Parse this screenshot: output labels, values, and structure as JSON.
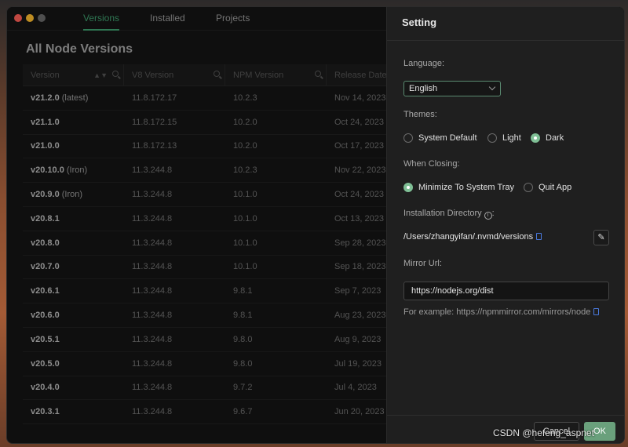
{
  "window": {
    "tabs": [
      {
        "label": "Versions",
        "active": true
      },
      {
        "label": "Installed",
        "active": false
      },
      {
        "label": "Projects",
        "active": false
      }
    ]
  },
  "page_title": "All Node Versions",
  "table": {
    "headers": [
      "Version",
      "V8 Version",
      "NPM Version",
      "Release Date"
    ],
    "rows": [
      {
        "version": "v21.2.0",
        "tag": "(latest)",
        "v8": "11.8.172.17",
        "npm": "10.2.3",
        "date": "Nov 14, 2023"
      },
      {
        "version": "v21.1.0",
        "tag": "",
        "v8": "11.8.172.15",
        "npm": "10.2.0",
        "date": "Oct 24, 2023"
      },
      {
        "version": "v21.0.0",
        "tag": "",
        "v8": "11.8.172.13",
        "npm": "10.2.0",
        "date": "Oct 17, 2023"
      },
      {
        "version": "v20.10.0",
        "tag": "(Iron)",
        "v8": "11.3.244.8",
        "npm": "10.2.3",
        "date": "Nov 22, 2023"
      },
      {
        "version": "v20.9.0",
        "tag": "(Iron)",
        "v8": "11.3.244.8",
        "npm": "10.1.0",
        "date": "Oct 24, 2023"
      },
      {
        "version": "v20.8.1",
        "tag": "",
        "v8": "11.3.244.8",
        "npm": "10.1.0",
        "date": "Oct 13, 2023"
      },
      {
        "version": "v20.8.0",
        "tag": "",
        "v8": "11.3.244.8",
        "npm": "10.1.0",
        "date": "Sep 28, 2023"
      },
      {
        "version": "v20.7.0",
        "tag": "",
        "v8": "11.3.244.8",
        "npm": "10.1.0",
        "date": "Sep 18, 2023"
      },
      {
        "version": "v20.6.1",
        "tag": "",
        "v8": "11.3.244.8",
        "npm": "9.8.1",
        "date": "Sep 7, 2023"
      },
      {
        "version": "v20.6.0",
        "tag": "",
        "v8": "11.3.244.8",
        "npm": "9.8.1",
        "date": "Aug 23, 2023"
      },
      {
        "version": "v20.5.1",
        "tag": "",
        "v8": "11.3.244.8",
        "npm": "9.8.0",
        "date": "Aug 9, 2023"
      },
      {
        "version": "v20.5.0",
        "tag": "",
        "v8": "11.3.244.8",
        "npm": "9.8.0",
        "date": "Jul 19, 2023"
      },
      {
        "version": "v20.4.0",
        "tag": "",
        "v8": "11.3.244.8",
        "npm": "9.7.2",
        "date": "Jul 4, 2023"
      },
      {
        "version": "v20.3.1",
        "tag": "",
        "v8": "11.3.244.8",
        "npm": "9.6.7",
        "date": "Jun 20, 2023"
      }
    ]
  },
  "setting": {
    "title": "Setting",
    "language_label": "Language:",
    "language_value": "English",
    "themes_label": "Themes:",
    "themes": [
      {
        "label": "System Default",
        "checked": false
      },
      {
        "label": "Light",
        "checked": false
      },
      {
        "label": "Dark",
        "checked": true
      }
    ],
    "closing_label": "When Closing:",
    "closing": [
      {
        "label": "Minimize To System Tray",
        "checked": true
      },
      {
        "label": "Quit App",
        "checked": false
      }
    ],
    "dir_label": "Installation Directory",
    "dir_value": "/Users/zhangyifan/.nvmd/versions",
    "mirror_label": "Mirror Url:",
    "mirror_value": "https://nodejs.org/dist",
    "example": "For example: https://npmmirror.com/mirrors/node",
    "cancel": "Cancel",
    "ok": "OK"
  },
  "watermark": "CSDN @hefeng_aspnet",
  "colors": {
    "accent": "#3f9f6f",
    "radio_on": "#7fbf95",
    "ok_button": "#6aa07c"
  }
}
